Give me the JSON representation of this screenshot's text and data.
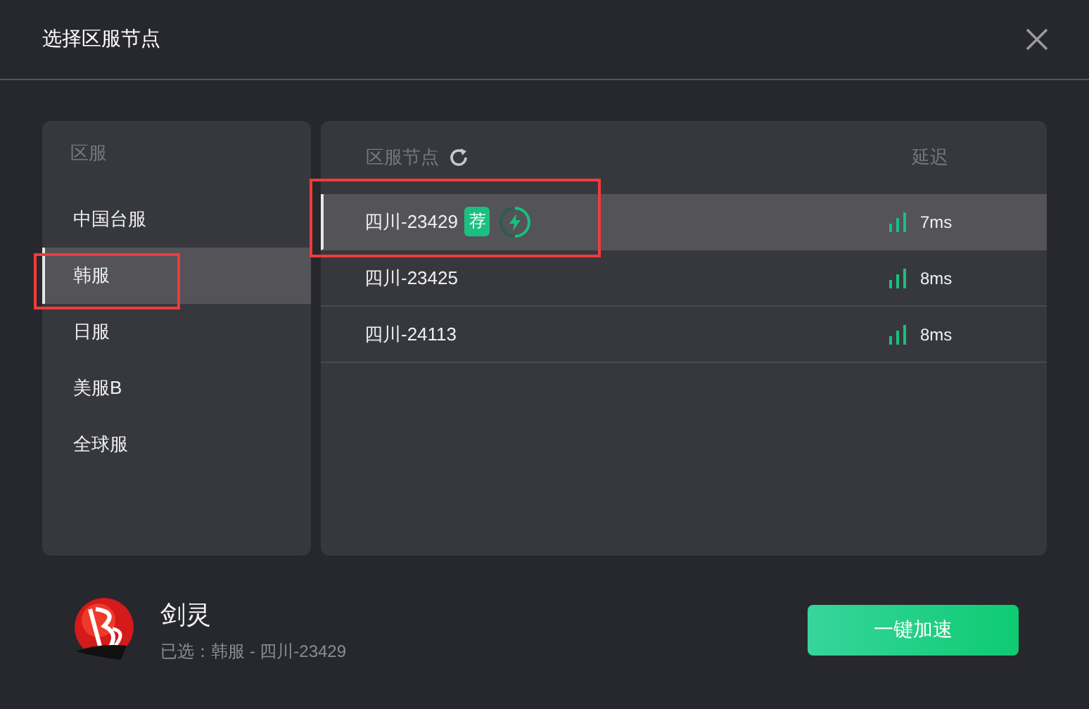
{
  "dialog": {
    "title": "选择区服节点"
  },
  "regions": {
    "header": "区服",
    "items": [
      {
        "label": "中国台服",
        "selected": false,
        "annotated": false
      },
      {
        "label": "韩服",
        "selected": true,
        "annotated": true
      },
      {
        "label": "日服",
        "selected": false,
        "annotated": false
      },
      {
        "label": "美服B",
        "selected": false,
        "annotated": false
      },
      {
        "label": "全球服",
        "selected": false,
        "annotated": false
      }
    ]
  },
  "nodes": {
    "header": "区服节点",
    "latency_header": "延迟",
    "rows": [
      {
        "name": "四川-23429",
        "badge": "荐",
        "boost": true,
        "selected": true,
        "annotated": true,
        "latency": "7ms"
      },
      {
        "name": "四川-23425",
        "boost": false,
        "selected": false,
        "annotated": false,
        "latency": "8ms"
      },
      {
        "name": "四川-24113",
        "boost": false,
        "selected": false,
        "annotated": false,
        "latency": "8ms"
      }
    ]
  },
  "game": {
    "name": "剑灵",
    "selection": "已选：韩服 - 四川-23429"
  },
  "accelerate_button": "一键加速"
}
